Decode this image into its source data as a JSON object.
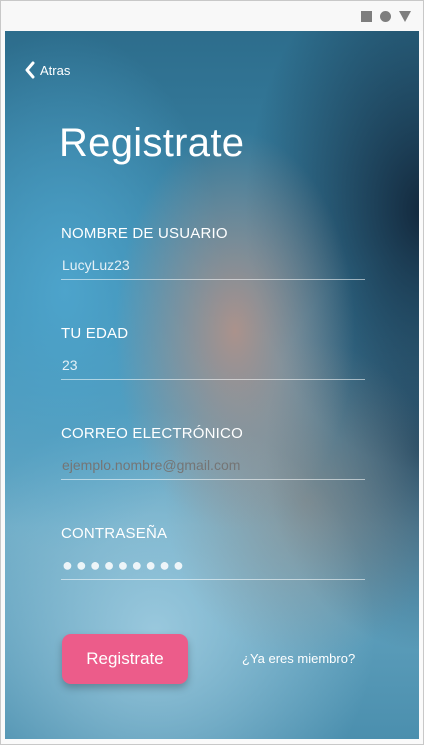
{
  "status_bar": {
    "icons": [
      "square-icon",
      "circle-icon",
      "triangle-icon"
    ]
  },
  "nav": {
    "back_label": "Atras",
    "back_icon": "chevron-left-icon"
  },
  "page": {
    "title": "Registrate"
  },
  "form": {
    "username": {
      "label": "NOMBRE DE USUARIO",
      "value": "LucyLuz23"
    },
    "age": {
      "label": "TU EDAD",
      "value": "23"
    },
    "email": {
      "label": "CORREO ELECTRÓNICO",
      "placeholder": "ejemplo.nombre@gmail.com",
      "value": ""
    },
    "password": {
      "label": "CONTRASEÑA",
      "value": "●●●●●●●●●"
    }
  },
  "actions": {
    "submit_label": "Registrate",
    "member_link": "¿Ya eres miembro?"
  },
  "colors": {
    "accent": "#ec5c8a",
    "text": "#ffffff",
    "status_icons": "#7e7e7e"
  }
}
